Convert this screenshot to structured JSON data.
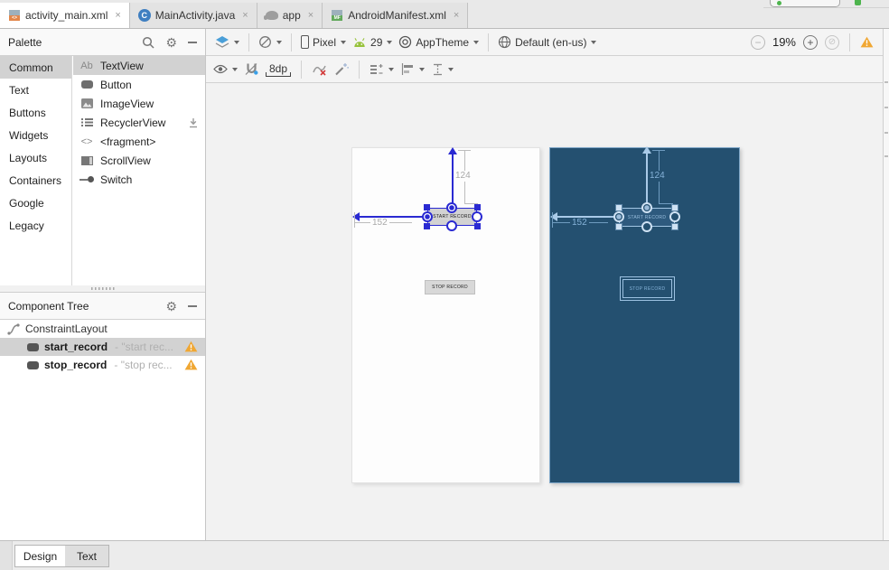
{
  "tabs": [
    {
      "label": "activity_main.xml"
    },
    {
      "label": "MainActivity.java",
      "badge": "C"
    },
    {
      "label": "app"
    },
    {
      "label": "AndroidManifest.xml",
      "badge": "MF"
    }
  ],
  "palette": {
    "title": "Palette",
    "categories": [
      "Common",
      "Text",
      "Buttons",
      "Widgets",
      "Layouts",
      "Containers",
      "Google",
      "Legacy"
    ],
    "selected_category": "Common",
    "items": [
      {
        "label": "TextView",
        "icon_text": "Ab"
      },
      {
        "label": "Button"
      },
      {
        "label": "ImageView"
      },
      {
        "label": "RecyclerView"
      },
      {
        "label": "<fragment>",
        "icon_text": "<>"
      },
      {
        "label": "ScrollView"
      },
      {
        "label": "Switch"
      }
    ],
    "selected_item": "TextView"
  },
  "toolbar": {
    "device": "Pixel",
    "api_level": "29",
    "theme": "AppTheme",
    "locale": "Default (en-us)",
    "zoom_percent": "19%",
    "default_margin": "8dp"
  },
  "component_tree": {
    "title": "Component Tree",
    "nodes": [
      {
        "label": "ConstraintLayout"
      },
      {
        "label": "start_record",
        "value": "- \"start rec...",
        "selected": true,
        "warning": true
      },
      {
        "label": "stop_record",
        "value": "- \"stop rec...",
        "warning": true
      }
    ]
  },
  "canvas": {
    "start_button_label": "START RECORD",
    "stop_button_label": "STOP RECORD",
    "margin_top": "124",
    "margin_left": "152"
  },
  "bottom_tabs": [
    {
      "label": "Design",
      "active": true
    },
    {
      "label": "Text",
      "active": false
    }
  ],
  "colors": {
    "blueprint_bg": "#245070",
    "constraint_blue": "#2a2ad2",
    "selection_gray": "#d2d2d2",
    "warning_orange": "#f0a733"
  }
}
